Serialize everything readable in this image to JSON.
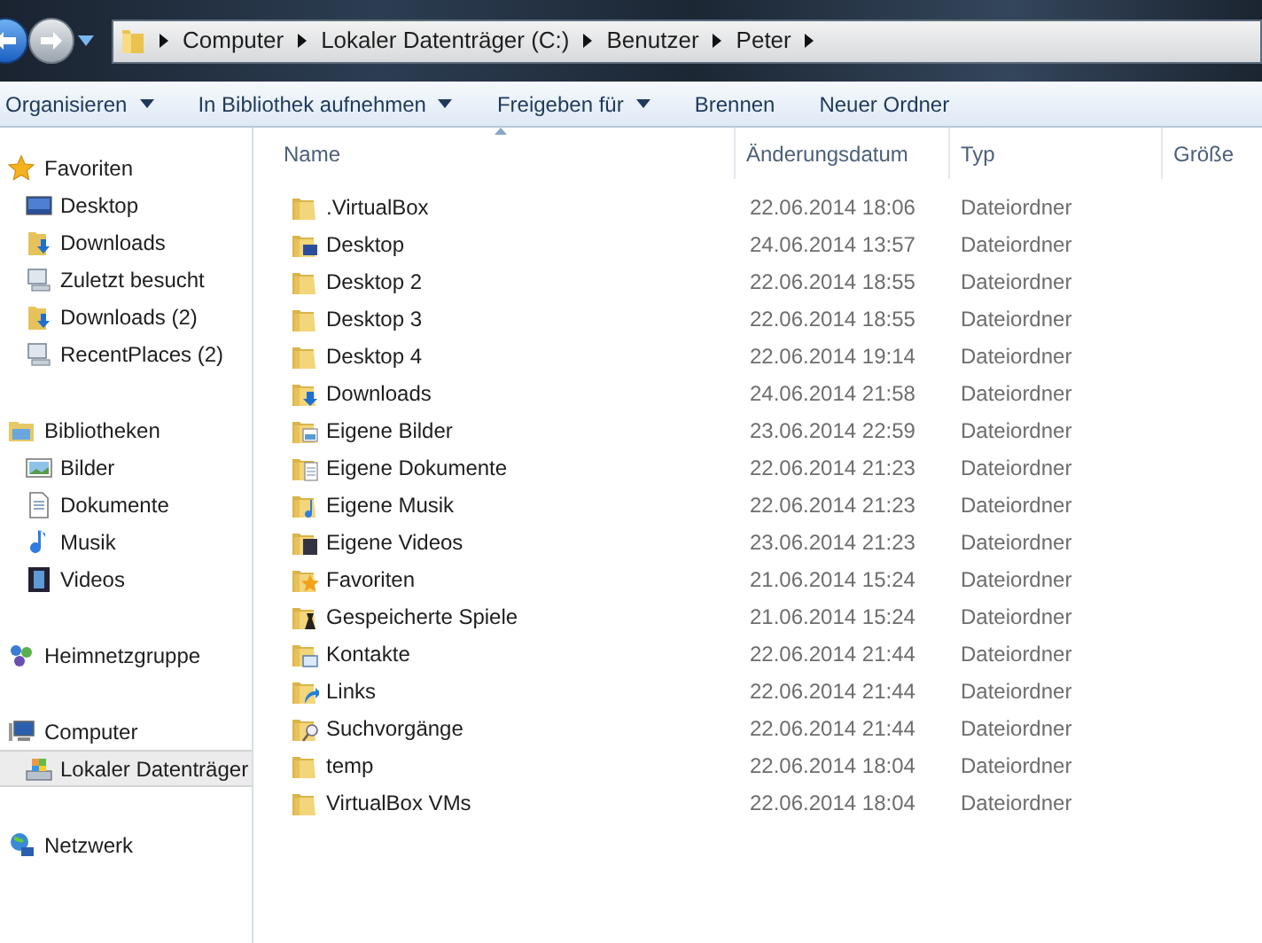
{
  "navigation": [
    {
      "kind": "back",
      "disabled": false
    },
    {
      "kind": "forward",
      "disabled": true
    }
  ],
  "breadcrumb": [
    "Computer",
    "Lokaler Datenträger (C:)",
    "Benutzer",
    "Peter"
  ],
  "toolbar": [
    {
      "label": "Organisieren",
      "has_menu": true
    },
    {
      "label": "In Bibliothek aufnehmen",
      "has_menu": true
    },
    {
      "label": "Freigeben für",
      "has_menu": true
    },
    {
      "label": "Brennen",
      "has_menu": false
    },
    {
      "label": "Neuer Ordner",
      "has_menu": false
    }
  ],
  "sidebar": [
    {
      "label": "Favoriten",
      "kind": "star",
      "selected": false,
      "children": [
        {
          "label": "Desktop",
          "kind": "desktop",
          "selected": false
        },
        {
          "label": "Downloads",
          "kind": "download",
          "selected": false
        },
        {
          "label": "Zuletzt besucht",
          "kind": "recent",
          "selected": false
        },
        {
          "label": "Downloads (2)",
          "kind": "download",
          "selected": false
        },
        {
          "label": "RecentPlaces (2)",
          "kind": "recent",
          "selected": false
        }
      ]
    },
    {
      "label": "Bibliotheken",
      "kind": "library",
      "selected": false,
      "children": [
        {
          "label": "Bilder",
          "kind": "pictures",
          "selected": false
        },
        {
          "label": "Dokumente",
          "kind": "documents",
          "selected": false
        },
        {
          "label": "Musik",
          "kind": "music",
          "selected": false
        },
        {
          "label": "Videos",
          "kind": "videos",
          "selected": false
        }
      ]
    },
    {
      "label": "Heimnetzgruppe",
      "kind": "homegroup",
      "selected": false
    },
    {
      "label": "Computer",
      "kind": "computer",
      "selected": false,
      "children": [
        {
          "label": "Lokaler Datenträger",
          "kind": "drive",
          "selected": true
        }
      ]
    },
    {
      "label": "Netzwerk",
      "kind": "network",
      "selected": false
    }
  ],
  "columns": [
    {
      "label": "Name",
      "sorted": true
    },
    {
      "label": "Änderungsdatum",
      "sorted": false
    },
    {
      "label": "Typ",
      "sorted": false
    },
    {
      "label": "Größe",
      "sorted": false
    }
  ],
  "files": [
    {
      "name": ".VirtualBox",
      "kind": "plain",
      "date": "22.06.2014 18:06",
      "type": "Dateiordner"
    },
    {
      "name": "Desktop",
      "kind": "desktop",
      "date": "24.06.2014 13:57",
      "type": "Dateiordner"
    },
    {
      "name": "Desktop 2",
      "kind": "plain",
      "date": "22.06.2014 18:55",
      "type": "Dateiordner"
    },
    {
      "name": "Desktop 3",
      "kind": "plain",
      "date": "22.06.2014 18:55",
      "type": "Dateiordner"
    },
    {
      "name": "Desktop 4",
      "kind": "plain",
      "date": "22.06.2014 19:14",
      "type": "Dateiordner"
    },
    {
      "name": "Downloads",
      "kind": "download",
      "date": "24.06.2014 21:58",
      "type": "Dateiordner"
    },
    {
      "name": "Eigene Bilder",
      "kind": "pictures",
      "date": "23.06.2014 22:59",
      "type": "Dateiordner"
    },
    {
      "name": "Eigene Dokumente",
      "kind": "documents",
      "date": "22.06.2014 21:23",
      "type": "Dateiordner"
    },
    {
      "name": "Eigene Musik",
      "kind": "music",
      "date": "22.06.2014 21:23",
      "type": "Dateiordner"
    },
    {
      "name": "Eigene Videos",
      "kind": "videos",
      "date": "23.06.2014 21:23",
      "type": "Dateiordner"
    },
    {
      "name": "Favoriten",
      "kind": "star",
      "date": "21.06.2014 15:24",
      "type": "Dateiordner"
    },
    {
      "name": "Gespeicherte Spiele",
      "kind": "games",
      "date": "21.06.2014 15:24",
      "type": "Dateiordner"
    },
    {
      "name": "Kontakte",
      "kind": "contacts",
      "date": "22.06.2014 21:44",
      "type": "Dateiordner"
    },
    {
      "name": "Links",
      "kind": "links",
      "date": "22.06.2014 21:44",
      "type": "Dateiordner"
    },
    {
      "name": "Suchvorgänge",
      "kind": "search",
      "date": "22.06.2014 21:44",
      "type": "Dateiordner"
    },
    {
      "name": "temp",
      "kind": "plain",
      "date": "22.06.2014 18:04",
      "type": "Dateiordner"
    },
    {
      "name": "VirtualBox VMs",
      "kind": "plain",
      "date": "22.06.2014 18:04",
      "type": "Dateiordner"
    }
  ]
}
